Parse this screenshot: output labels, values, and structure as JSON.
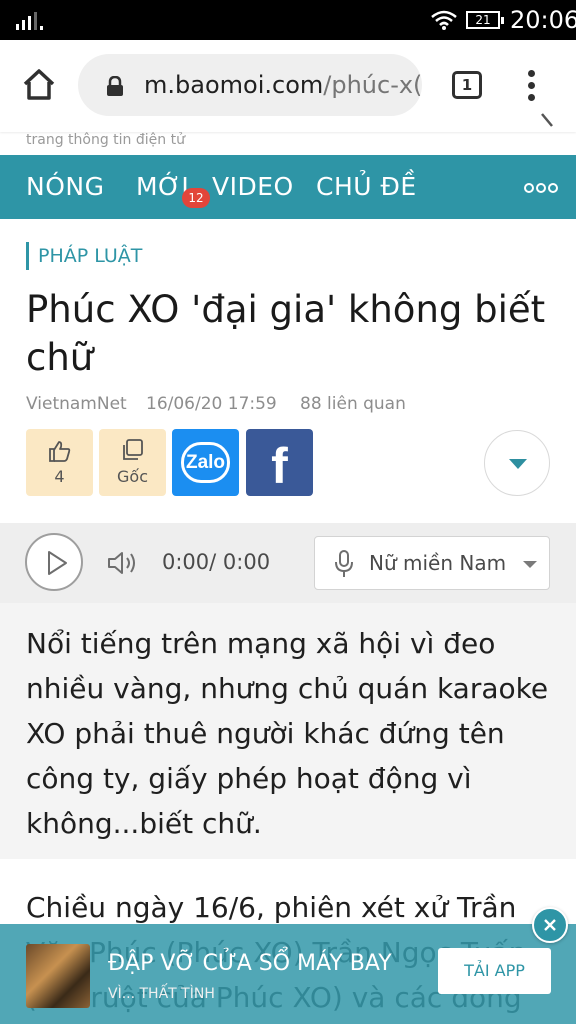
{
  "status_bar": {
    "time": "20:06",
    "battery": "21"
  },
  "browser": {
    "url_host": "m.baomoi.com",
    "url_path": "/phúc-x(",
    "tab_count": "1"
  },
  "site": {
    "tagline": "trang thông tin điện tử"
  },
  "nav": {
    "items": [
      "NÓNG",
      "MỚI",
      "VIDEO",
      "CHỦ ĐỀ"
    ],
    "new_badge": "12",
    "more_icon": "more-dots-icon",
    "bg_color": "#2e95a6"
  },
  "article": {
    "category": "PHÁP LUẬT",
    "title": "Phúc XO 'đại gia' không biết chữ",
    "source": "VietnamNet",
    "datetime": "16/06/20 17:59",
    "related": "88 liên quan",
    "actions": {
      "like_count": "4",
      "source_label": "Gốc",
      "zalo_label": "Zalo",
      "facebook_label": "f"
    },
    "lead": "Nổi tiếng trên mạng xã hội vì đeo nhiều vàng, nhưng chủ quán karaoke XO phải thuê người khác đứng tên công ty, giấy phép hoạt động vì không...biết chữ.",
    "body_first": "Chiều ngày 16/6, phiên xét xử Trần Văn Phúc (Phúc XO) Trần Ngọc Tuấn (em ruột của Phúc XO) và các đồng"
  },
  "audio": {
    "time": "0:00/ 0:00",
    "voice": "Nữ miền Nam"
  },
  "ad": {
    "title": "ĐẬP VỠ CỬA SỔ MÁY BAY",
    "subtitle": "VÌ... THẤT TÌNH",
    "button_label": "TẢI APP"
  }
}
